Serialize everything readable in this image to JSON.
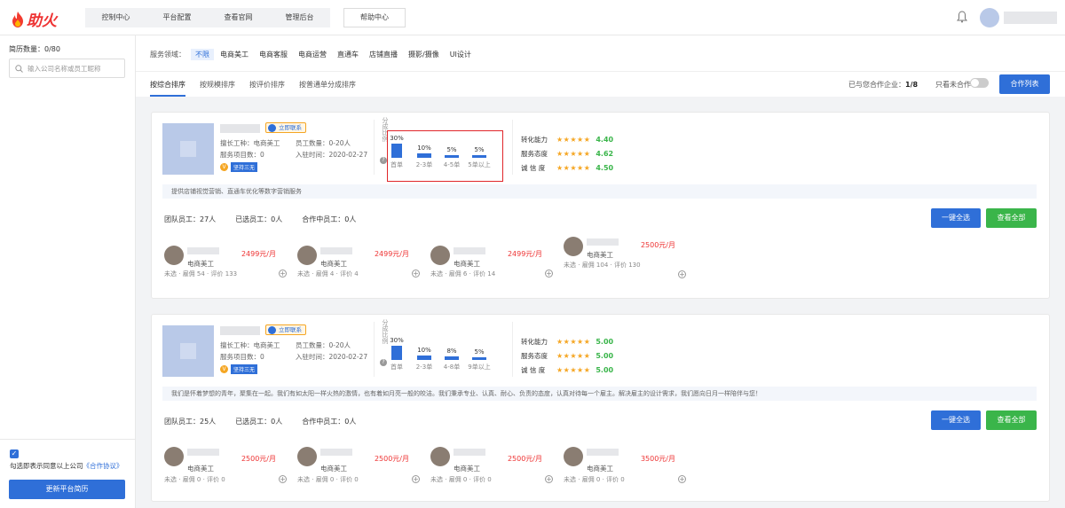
{
  "app": {
    "logo_text": "助火",
    "brand_color": "#e33"
  },
  "nav": {
    "items": [
      "控制中心",
      "平台配置",
      "查看官网",
      "管理后台"
    ],
    "help": "帮助中心"
  },
  "sidebar": {
    "count": "简历数量：0/80",
    "search_placeholder": "输入公司名称或员工昵称",
    "agree_text": "勾选即表示同意以上公司",
    "agree_link": "《合作协议》",
    "update_button": "更新平台简历"
  },
  "filters": {
    "label": "服务领域：",
    "options": [
      "不限",
      "电商美工",
      "电商客服",
      "电商运营",
      "直通车",
      "店铺直播",
      "摄影/摄像",
      "UI设计"
    ],
    "sort_tabs": [
      "按综合排序",
      "按规模排序",
      "按评价排序",
      "按普通单分成排序"
    ],
    "coop_label": "已与您合作企业：",
    "coop_value": "1/8",
    "only_label": "只看未合作",
    "coop_button": "合作列表"
  },
  "companies": [
    {
      "contact": "立即联系",
      "meta": [
        "擅长工种：电商美工",
        "员工数量：0-20人",
        "服务项目数：0",
        "入驻时间：2020-02-27"
      ],
      "badge_v": "V",
      "badge": "坚持三无",
      "dist_vlabel": "分成比例",
      "dist": [
        {
          "pct": "30%",
          "label": "首单",
          "value": 30
        },
        {
          "pct": "10%",
          "label": "2-3单",
          "value": 10
        },
        {
          "pct": "5%",
          "label": "4-5单",
          "value": 5
        },
        {
          "pct": "5%",
          "label": "5单以上",
          "value": 5
        }
      ],
      "scores": [
        {
          "label": "转化能力",
          "stars": "★★★★★",
          "value": "4.40"
        },
        {
          "label": "服务态度",
          "stars": "★★★★★",
          "value": "4.62"
        },
        {
          "label": "诚 信 度",
          "stars": "★★★★★",
          "value": "4.50"
        }
      ],
      "desc": "提供店铺视觉营销、直通车优化等数字营销服务",
      "team": [
        "团队员工：27人",
        "已选员工：0人",
        "合作中员工：0人"
      ],
      "select_all": "一键全选",
      "view_all": "查看全部",
      "employees": [
        {
          "price": "2499元/月",
          "role": "电商美工",
          "status": "未选",
          "hire": "雇佣 54",
          "rate": "评价 133"
        },
        {
          "price": "2499元/月",
          "role": "电商美工",
          "status": "未选",
          "hire": "雇佣 4",
          "rate": "评价 4"
        },
        {
          "price": "2499元/月",
          "role": "电商美工",
          "status": "未选",
          "hire": "雇佣 6",
          "rate": "评价 14"
        },
        {
          "price": "2500元/月",
          "role": "电商美工",
          "status": "未选",
          "hire": "雇佣 104",
          "rate": "评价 130"
        }
      ]
    },
    {
      "contact": "立即联系",
      "meta": [
        "擅长工种：电商美工",
        "员工数量：0-20人",
        "服务项目数：0",
        "入驻时间：2020-02-27"
      ],
      "badge_v": "V",
      "badge": "坚持三无",
      "dist_vlabel": "分成比例",
      "dist": [
        {
          "pct": "30%",
          "label": "首单",
          "value": 30
        },
        {
          "pct": "10%",
          "label": "2-3单",
          "value": 10
        },
        {
          "pct": "8%",
          "label": "4-8单",
          "value": 8
        },
        {
          "pct": "5%",
          "label": "9单以上",
          "value": 5
        }
      ],
      "scores": [
        {
          "label": "转化能力",
          "stars": "★★★★★",
          "value": "5.00"
        },
        {
          "label": "服务态度",
          "stars": "★★★★★",
          "value": "5.00"
        },
        {
          "label": "诚 信 度",
          "stars": "★★★★★",
          "value": "5.00"
        }
      ],
      "desc": "我们是怀着梦想的青年，聚集在一起。我们有如太阳一样火热的激情，也有着如月亮一般的皎洁。我们秉承专业、认真、耐心、负责的态度，认真对待每一个雇主。解决雇主的设计需求，我们愿向日月一样陪伴与您！",
      "team": [
        "团队员工：25人",
        "已选员工：0人",
        "合作中员工：0人"
      ],
      "select_all": "一键全选",
      "view_all": "查看全部",
      "employees": [
        {
          "price": "2500元/月",
          "role": "电商美工",
          "status": "未选",
          "hire": "雇佣 0",
          "rate": "评价 0"
        },
        {
          "price": "2500元/月",
          "role": "电商美工",
          "status": "未选",
          "hire": "雇佣 0",
          "rate": "评价 0"
        },
        {
          "price": "2500元/月",
          "role": "电商美工",
          "status": "未选",
          "hire": "雇佣 0",
          "rate": "评价 0"
        },
        {
          "price": "3500元/月",
          "role": "电商美工",
          "status": "未选",
          "hire": "雇佣 0",
          "rate": "评价 0"
        }
      ]
    }
  ]
}
